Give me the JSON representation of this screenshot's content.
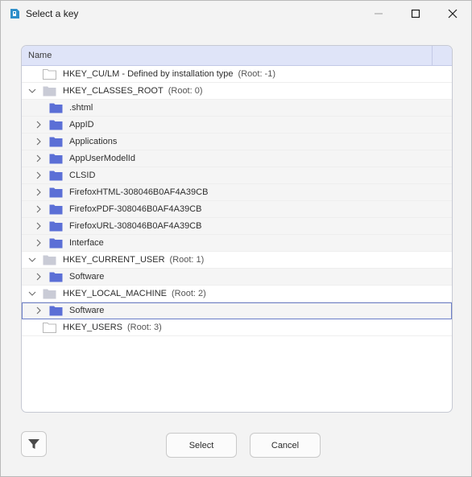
{
  "window": {
    "title": "Select a key",
    "controls": {
      "minimize": "minimize-icon",
      "maximize": "maximize-icon",
      "close": "close-icon"
    }
  },
  "tree": {
    "header": "Name",
    "rows": [
      {
        "label": "HKEY_CU/LM - Defined by installation type",
        "root": "(Root: -1)",
        "level": 0,
        "chevron": "none",
        "folder": "outline"
      },
      {
        "label": "HKEY_CLASSES_ROOT",
        "root": "(Root: 0)",
        "level": 0,
        "chevron": "down",
        "folder": "gray"
      },
      {
        "label": ".shtml",
        "root": "",
        "level": 1,
        "chevron": "none",
        "folder": "blue"
      },
      {
        "label": "AppID",
        "root": "",
        "level": 1,
        "chevron": "right",
        "folder": "blue"
      },
      {
        "label": "Applications",
        "root": "",
        "level": 1,
        "chevron": "right",
        "folder": "blue"
      },
      {
        "label": "AppUserModelId",
        "root": "",
        "level": 1,
        "chevron": "right",
        "folder": "blue"
      },
      {
        "label": "CLSID",
        "root": "",
        "level": 1,
        "chevron": "right",
        "folder": "blue"
      },
      {
        "label": "FirefoxHTML-308046B0AF4A39CB",
        "root": "",
        "level": 1,
        "chevron": "right",
        "folder": "blue"
      },
      {
        "label": "FirefoxPDF-308046B0AF4A39CB",
        "root": "",
        "level": 1,
        "chevron": "right",
        "folder": "blue"
      },
      {
        "label": "FirefoxURL-308046B0AF4A39CB",
        "root": "",
        "level": 1,
        "chevron": "right",
        "folder": "blue"
      },
      {
        "label": "Interface",
        "root": "",
        "level": 1,
        "chevron": "right",
        "folder": "blue"
      },
      {
        "label": "HKEY_CURRENT_USER",
        "root": "(Root: 1)",
        "level": 0,
        "chevron": "down",
        "folder": "gray"
      },
      {
        "label": "Software",
        "root": "",
        "level": 1,
        "chevron": "right",
        "folder": "blue"
      },
      {
        "label": "HKEY_LOCAL_MACHINE",
        "root": "(Root: 2)",
        "level": 0,
        "chevron": "down",
        "folder": "gray"
      },
      {
        "label": "Software",
        "root": "",
        "level": 1,
        "chevron": "right",
        "folder": "blue",
        "selected": true
      },
      {
        "label": "HKEY_USERS",
        "root": "(Root: 3)",
        "level": 0,
        "chevron": "none",
        "folder": "outline"
      }
    ]
  },
  "footer": {
    "filter_icon": "filter-icon",
    "select_label": "Select",
    "cancel_label": "Cancel"
  },
  "colors": {
    "accent": "#5b6fd6",
    "header_bg": "#dfe4f8",
    "folder_gray": "#c9cbd6",
    "selection_outline": "#6b7ec8"
  }
}
